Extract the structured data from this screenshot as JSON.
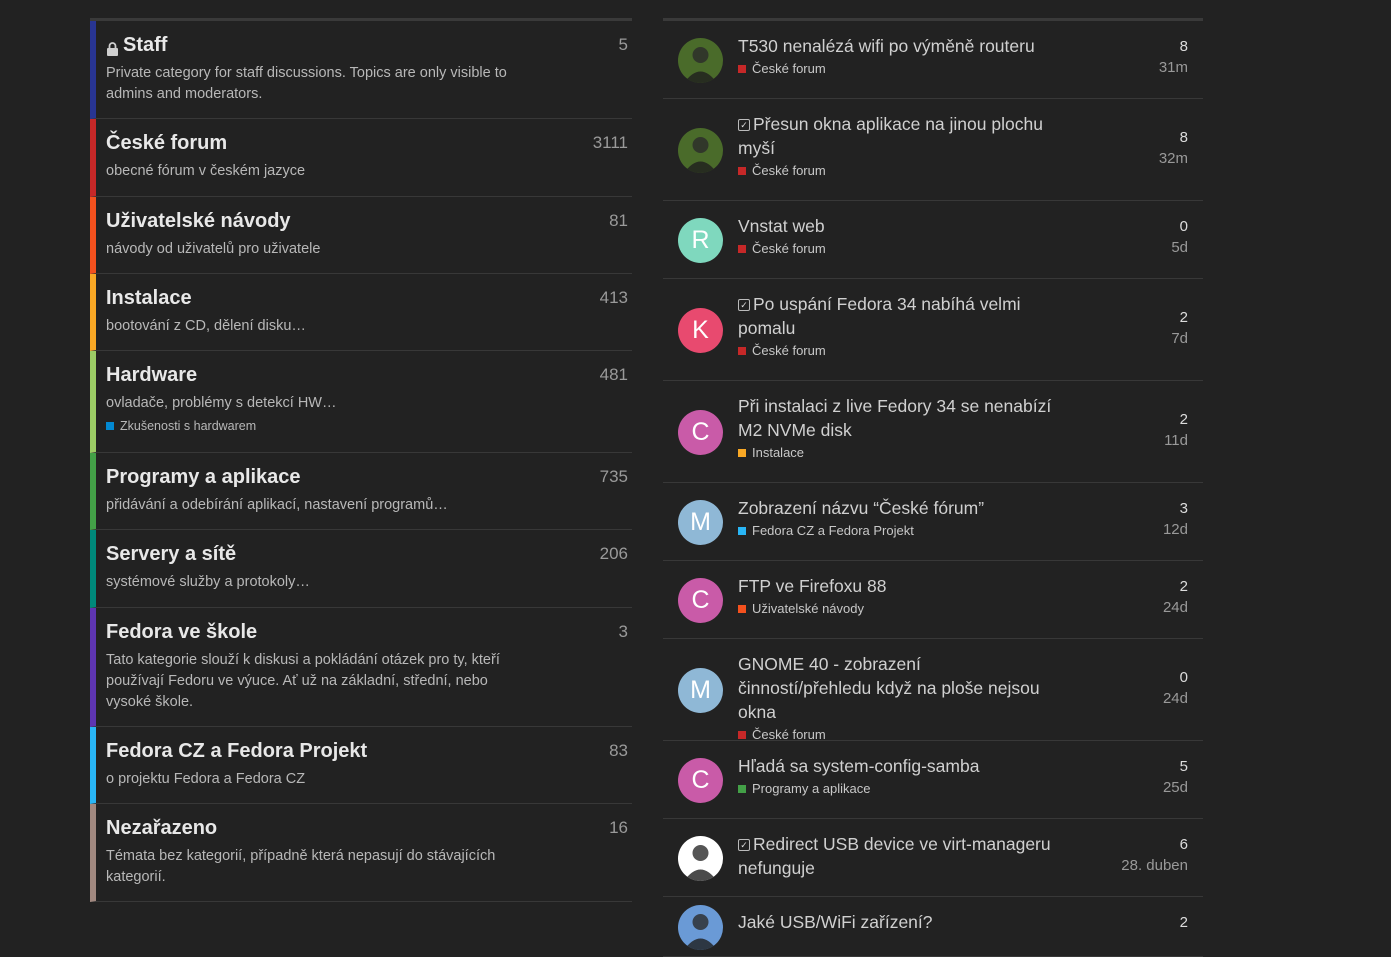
{
  "categories": [
    {
      "name": "Staff",
      "desc": "Private category for staff discussions. Topics are only visible to admins and moderators.",
      "count": "5",
      "color": "#283593",
      "locked": true
    },
    {
      "name": "České forum",
      "desc": "obecné fórum v českém jazyce",
      "count": "3111",
      "color": "#c62828"
    },
    {
      "name": "Uživatelské návody",
      "desc": "návody od uživatelů pro uživatele",
      "count": "81",
      "color": "#f4511e"
    },
    {
      "name": "Instalace",
      "desc": "bootování z CD, dělení disku…",
      "count": "413",
      "color": "#f9a825"
    },
    {
      "name": "Hardware",
      "desc": "ovladače, problémy s detekcí HW…",
      "count": "481",
      "color": "#9ccc65",
      "sub_label": "Zkušenosti s hardwarem",
      "sub_color": "#0288d1"
    },
    {
      "name": "Programy a aplikace",
      "desc": "přidávání a odebírání aplikací, nastavení programů…",
      "count": "735",
      "color": "#43a047"
    },
    {
      "name": "Servery a sítě",
      "desc": "systémové služby a protokoly…",
      "count": "206",
      "color": "#00897b"
    },
    {
      "name": "Fedora ve škole",
      "desc": "Tato kategorie slouží k diskusi a pokládání otázek pro ty, kteří používají Fedoru ve výuce. Ať už na základní, střední, nebo vysoké škole.",
      "count": "3",
      "color": "#5e35b1"
    },
    {
      "name": "Fedora CZ a Fedora Projekt",
      "desc": "o projektu Fedora a Fedora CZ",
      "count": "83",
      "color": "#29b6f6"
    },
    {
      "name": "Nezařazeno",
      "desc": "Témata bez kategorií, případně která nepasují do stávajících kategorií.",
      "count": "16",
      "color": "#a1887f"
    }
  ],
  "topics": [
    {
      "title": "T530 nenalézá wifi po výměně routeru",
      "category": "České forum",
      "cat_color": "#c62828",
      "replies": "8",
      "ago": "31m",
      "avatar_letter": "",
      "avatar_color": "#4a6b2a",
      "avatar_icon": "photo-avatar",
      "solved": false
    },
    {
      "title": "Přesun okna aplikace na jinou plochu myší",
      "category": "České forum",
      "cat_color": "#c62828",
      "replies": "8",
      "ago": "32m",
      "avatar_letter": "",
      "avatar_color": "#4a6b2a",
      "avatar_icon": "photo-avatar",
      "solved": true
    },
    {
      "title": "Vnstat web",
      "category": "České forum",
      "cat_color": "#c62828",
      "replies": "0",
      "ago": "5d",
      "avatar_letter": "R",
      "avatar_color": "#7fd8be",
      "solved": false
    },
    {
      "title": "Po uspání Fedora 34 nabíhá velmi pomalu",
      "category": "České forum",
      "cat_color": "#c62828",
      "replies": "2",
      "ago": "7d",
      "avatar_letter": "K",
      "avatar_color": "#e84a6f",
      "solved": true
    },
    {
      "title": "Při instalaci z live Fedory 34 se nenabízí M2 NVMe disk",
      "category": "Instalace",
      "cat_color": "#f9a825",
      "replies": "2",
      "ago": "11d",
      "avatar_letter": "C",
      "avatar_color": "#c95ba8",
      "solved": false
    },
    {
      "title": "Zobrazení názvu “České fórum”",
      "category": "Fedora CZ a Fedora Projekt",
      "cat_color": "#29b6f6",
      "replies": "3",
      "ago": "12d",
      "avatar_letter": "M",
      "avatar_color": "#8fb8d6",
      "solved": false
    },
    {
      "title": "FTP ve Firefoxu 88",
      "category": "Uživatelské návody",
      "cat_color": "#f4511e",
      "replies": "2",
      "ago": "24d",
      "avatar_letter": "C",
      "avatar_color": "#c95ba8",
      "solved": false
    },
    {
      "title": "GNOME 40 - zobrazení činností/přehledu když na ploše nejsou okna",
      "category": "České forum",
      "cat_color": "#c62828",
      "replies": "0",
      "ago": "24d",
      "avatar_letter": "M",
      "avatar_color": "#8fb8d6",
      "solved": false
    },
    {
      "title": "Hľadá sa system-config-samba",
      "category": "Programy a aplikace",
      "cat_color": "#43a047",
      "replies": "5",
      "ago": "25d",
      "avatar_letter": "C",
      "avatar_color": "#c95ba8",
      "solved": false
    },
    {
      "title": "Redirect USB device ve virt-manageru nefunguje",
      "category": "",
      "cat_color": "",
      "replies": "6",
      "ago": "28. duben",
      "avatar_letter": "",
      "avatar_color": "#ffffff",
      "avatar_icon": "photo-avatar",
      "solved": true
    },
    {
      "title": "Jaké USB/WiFi zařízení?",
      "category": "",
      "cat_color": "",
      "replies": "2",
      "ago": "",
      "avatar_letter": "",
      "avatar_color": "#6a9ad6",
      "avatar_icon": "photo-avatar",
      "solved": false
    }
  ]
}
